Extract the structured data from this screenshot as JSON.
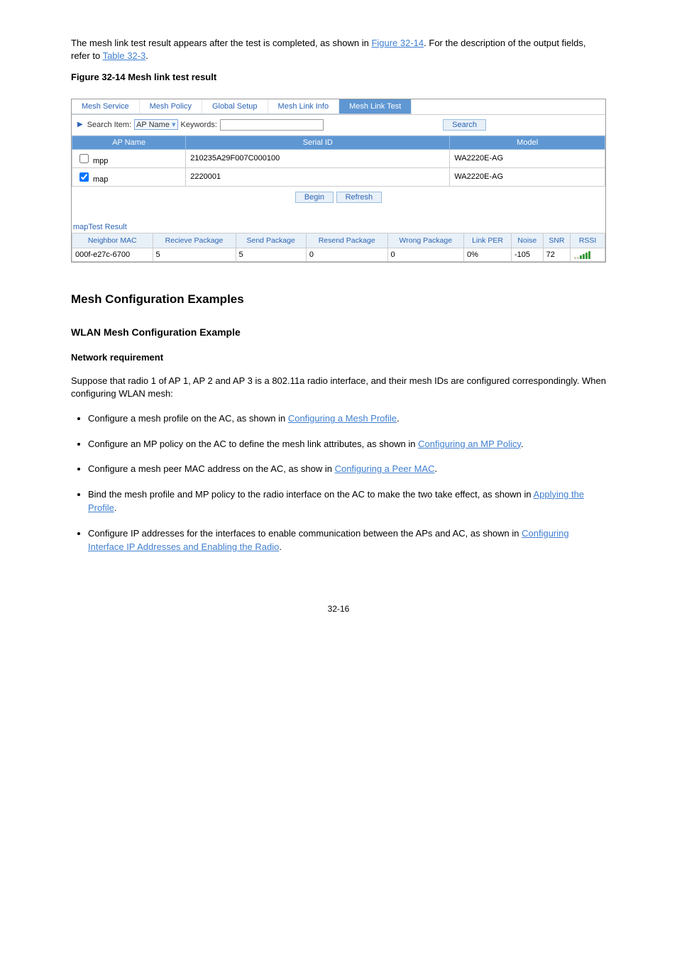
{
  "intro_text": "The mesh link test result appears after the test is completed, as shown in ",
  "intro_link": "Figure 32-14",
  "intro_tail": ". For the description of the output fields, refer to ",
  "intro_link2": "Table 32-3",
  "intro_period": ".",
  "fig14_caption": "Figure 32-14 Mesh link test result",
  "tabs": [
    "Mesh Service",
    "Mesh Policy",
    "Global Setup",
    "Mesh Link Info",
    "Mesh Link Test"
  ],
  "active_tab_index": 4,
  "search_label": "Search Item:",
  "search_select": "AP Name",
  "keywords_label": "Keywords:",
  "search_btn": "Search",
  "ap_headers": [
    "AP Name",
    "Serial ID",
    "Model"
  ],
  "ap_rows": [
    {
      "checked": false,
      "name": "mpp",
      "serial": "210235A29F007C000100",
      "model": "WA2220E-AG"
    },
    {
      "checked": true,
      "name": "map",
      "serial": "2220001",
      "model": "WA2220E-AG"
    }
  ],
  "begin_btn": "Begin",
  "refresh_btn": "Refresh",
  "result_title": "mapTest Result",
  "res_headers": [
    "Neighbor MAC",
    "Recieve Package",
    "Send Package",
    "Resend Package",
    "Wrong Package",
    "Link PER",
    "Noise",
    "SNR",
    "RSSI"
  ],
  "res_row": {
    "mac": "000f-e27c-6700",
    "recv": "5",
    "send": "5",
    "resend": "0",
    "wrong": "0",
    "per": "0%",
    "noise": "-105",
    "snr": "72"
  },
  "h2": "Mesh Configuration Examples",
  "h3": "WLAN Mesh Configuration Example",
  "h4": "Network requirement",
  "para": "Suppose that radio 1 of AP 1, AP 2 and AP 3 is a 802.11a radio interface, and their mesh IDs are configured correspondingly. When configuring WLAN mesh:",
  "bullets": [
    {
      "pre": "Configure a mesh profile on the AC, as shown in ",
      "link": "Configuring a Mesh Profile",
      "suf": "."
    },
    {
      "pre": "Configure an MP policy on the AC to define the mesh link attributes, as shown in ",
      "link": "Configuring an MP Policy",
      "suf": "."
    },
    {
      "pre": "Configure a mesh peer MAC address on the AC, as show in ",
      "link": "Configuring a Peer MAC",
      "suf": "."
    },
    {
      "pre": "Bind the mesh profile and MP policy to the radio interface on the AC to make the two take effect, as shown in ",
      "link": "Applying the Profile",
      "suf": "."
    },
    {
      "pre": "Configure IP addresses for the interfaces to enable communication between the APs and AC, as shown in ",
      "link": "Configuring Interface IP Addresses and Enabling the Radio",
      "suf": "."
    }
  ],
  "pagenum": "32-16"
}
